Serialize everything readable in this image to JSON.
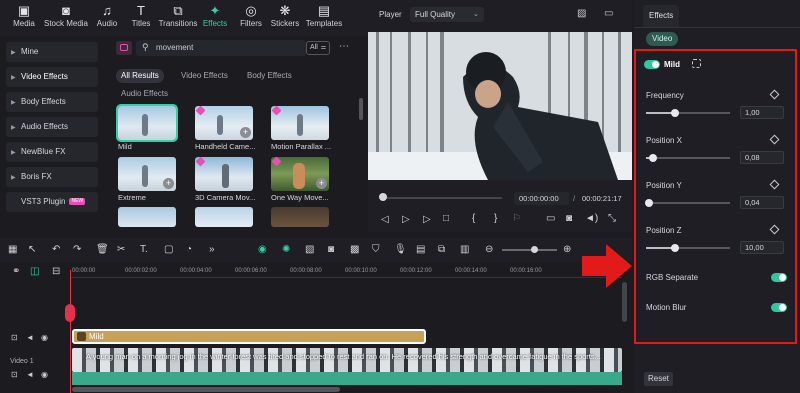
{
  "toolbar": {
    "items": [
      {
        "label": "Media",
        "icon": "media-icon"
      },
      {
        "label": "Stock Media",
        "icon": "stock-media-icon"
      },
      {
        "label": "Audio",
        "icon": "music-note-icon"
      },
      {
        "label": "Titles",
        "icon": "text-t-icon"
      },
      {
        "label": "Transitions",
        "icon": "transitions-icon"
      },
      {
        "label": "Effects",
        "icon": "sparkle-icon",
        "active": true
      },
      {
        "label": "Filters",
        "icon": "filters-icon"
      },
      {
        "label": "Stickers",
        "icon": "stickers-icon"
      },
      {
        "label": "Templates",
        "icon": "templates-icon"
      }
    ]
  },
  "categories": [
    {
      "label": "Mine"
    },
    {
      "label": "Video Effects"
    },
    {
      "label": "Body Effects"
    },
    {
      "label": "Audio Effects"
    },
    {
      "label": "NewBlue FX"
    },
    {
      "label": "Boris FX"
    },
    {
      "label": "VST3 Plugin",
      "badge": "NEW"
    }
  ],
  "library": {
    "search_value": "movement",
    "filter_label": "All",
    "tabs": [
      "All Results",
      "Video Effects",
      "Body Effects"
    ],
    "section_label": "Audio Effects",
    "items": [
      {
        "label": "Mild"
      },
      {
        "label": "Handheld Came..."
      },
      {
        "label": "Motion Parallax ..."
      },
      {
        "label": "Extreme"
      },
      {
        "label": "3D Camera Mov..."
      },
      {
        "label": "One Way Move..."
      }
    ]
  },
  "player": {
    "label": "Player",
    "quality": "Full Quality",
    "current_time": "00:00:00:00",
    "separator": "/",
    "total_time": "00:00:21:17"
  },
  "timeline": {
    "ruler": [
      "00:00:00",
      "00:00:02:00",
      "00:00:04:00",
      "00:00:06:00",
      "00:00:08:00",
      "00:00:10:00",
      "00:00:12:00",
      "00:00:14:00",
      "00:00:16:00"
    ],
    "effect_clip_label": "Mild",
    "video_clip_label": "A young man on a morning jog in the winter forest was tired and stopped to rest and ran on. He recovered his strength and overcame fatigue in the sports...",
    "track_label": "Video 1"
  },
  "effects_panel": {
    "tab": "Effects",
    "subtab": "Video",
    "effect_name": "Mild",
    "params": [
      {
        "label": "Frequency",
        "value": "1,00",
        "level": 0.35
      },
      {
        "label": "Position X",
        "value": "0,08",
        "level": 0.08
      },
      {
        "label": "Position Y",
        "value": "0,04",
        "level": 0.04
      },
      {
        "label": "Position Z",
        "value": "10,00",
        "level": 0.35
      }
    ],
    "toggles": [
      {
        "label": "RGB Separate",
        "on": true
      },
      {
        "label": "Motion Blur",
        "on": true
      }
    ],
    "reset_label": "Reset"
  },
  "colors": {
    "accent": "#31d0aa",
    "highlight": "#e21a1a",
    "effect_clip": "#c8a157",
    "video_track": "#3aa88a"
  }
}
